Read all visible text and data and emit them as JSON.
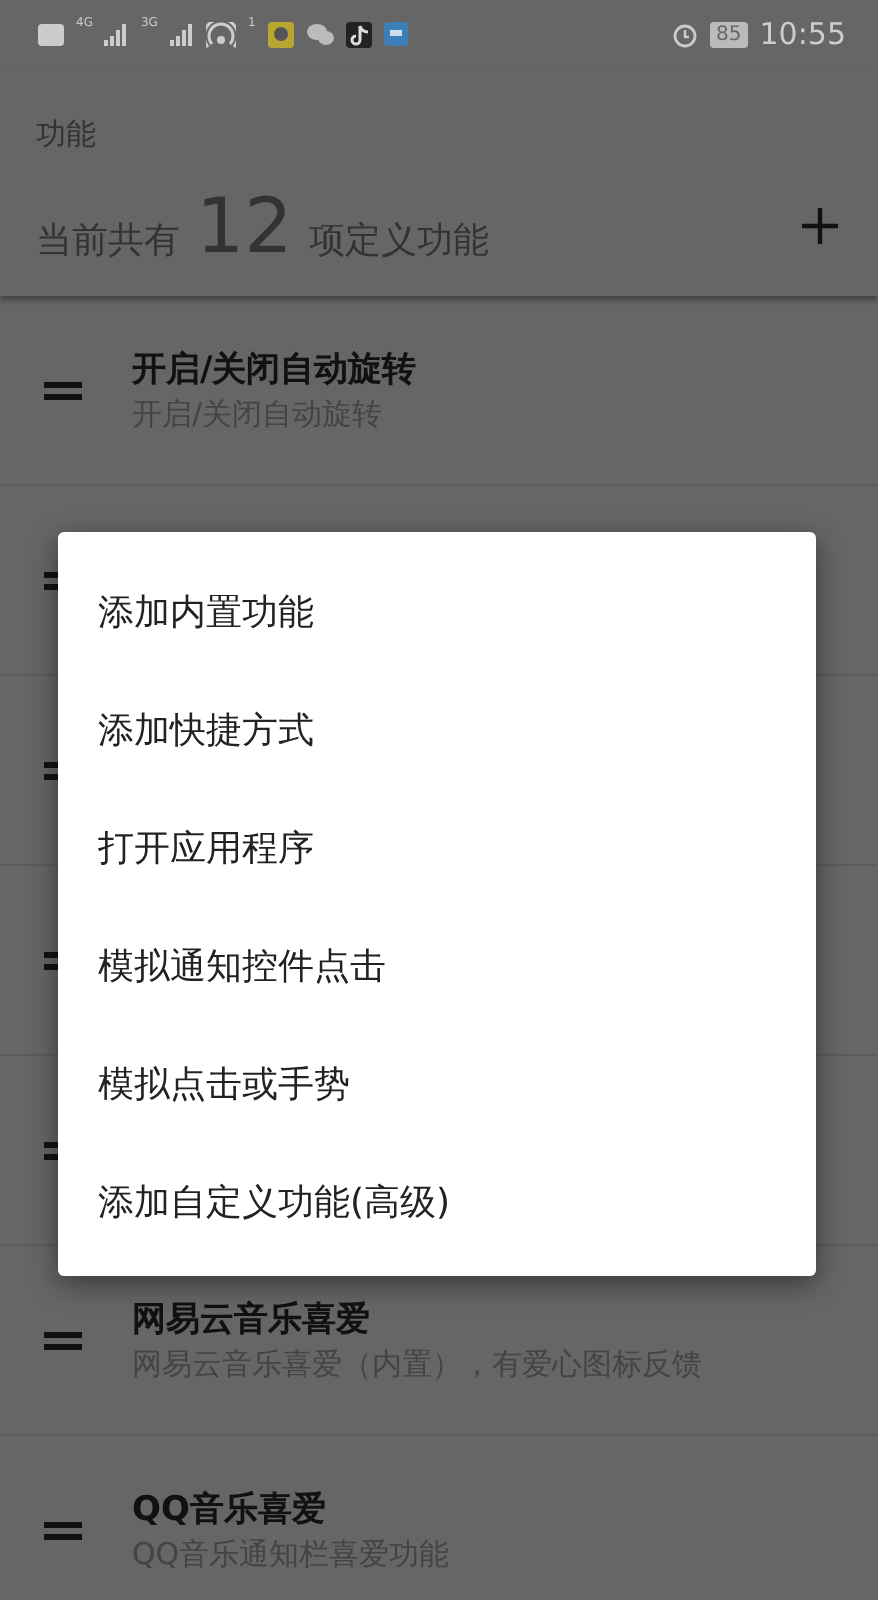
{
  "status_bar": {
    "networks": [
      {
        "label": "4G"
      },
      {
        "label": "3G"
      }
    ],
    "hotspot_count": "1",
    "battery": "85",
    "time": "10:55"
  },
  "header": {
    "title": "功能",
    "count_prefix": "当前共有",
    "count": "12",
    "count_suffix": "项定义功能"
  },
  "rows": [
    {
      "kind": "function",
      "title": "开启/关闭自动旋转",
      "subtitle": "开启/关闭自动旋转"
    },
    {
      "kind": "covered"
    },
    {
      "kind": "covered"
    },
    {
      "kind": "covered"
    },
    {
      "kind": "covered"
    },
    {
      "kind": "function",
      "title": "网易云音乐喜爱",
      "subtitle": "网易云音乐喜爱（内置），有爱心图标反馈"
    },
    {
      "kind": "function",
      "title": "QQ音乐喜爱",
      "subtitle": "QQ音乐通知栏喜爱功能"
    }
  ],
  "menu": {
    "items": [
      "添加内置功能",
      "添加快捷方式",
      "打开应用程序",
      "模拟通知控件点击",
      "模拟点击或手势",
      "添加自定义功能(高级)"
    ]
  }
}
